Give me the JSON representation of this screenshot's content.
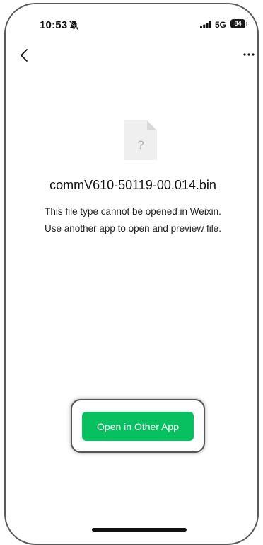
{
  "status_bar": {
    "time": "10:53",
    "network": "5G",
    "battery": "84",
    "icons": [
      "bell-muted-icon",
      "signal-icon"
    ]
  },
  "nav": {
    "back_icon": "chevron-left-icon",
    "more_icon": "more-dots-icon"
  },
  "file": {
    "icon": "unknown-file-icon",
    "icon_glyph": "?",
    "name": "commV610-50119-00.014.bin"
  },
  "message": {
    "line1": "This file type cannot be opened in Weixin.",
    "line2": "Use another app to open and preview file."
  },
  "actions": {
    "open_in_other_app": "Open in Other App"
  },
  "colors": {
    "accent": "#07c160",
    "background": "#ffffff",
    "text": "#111111"
  }
}
